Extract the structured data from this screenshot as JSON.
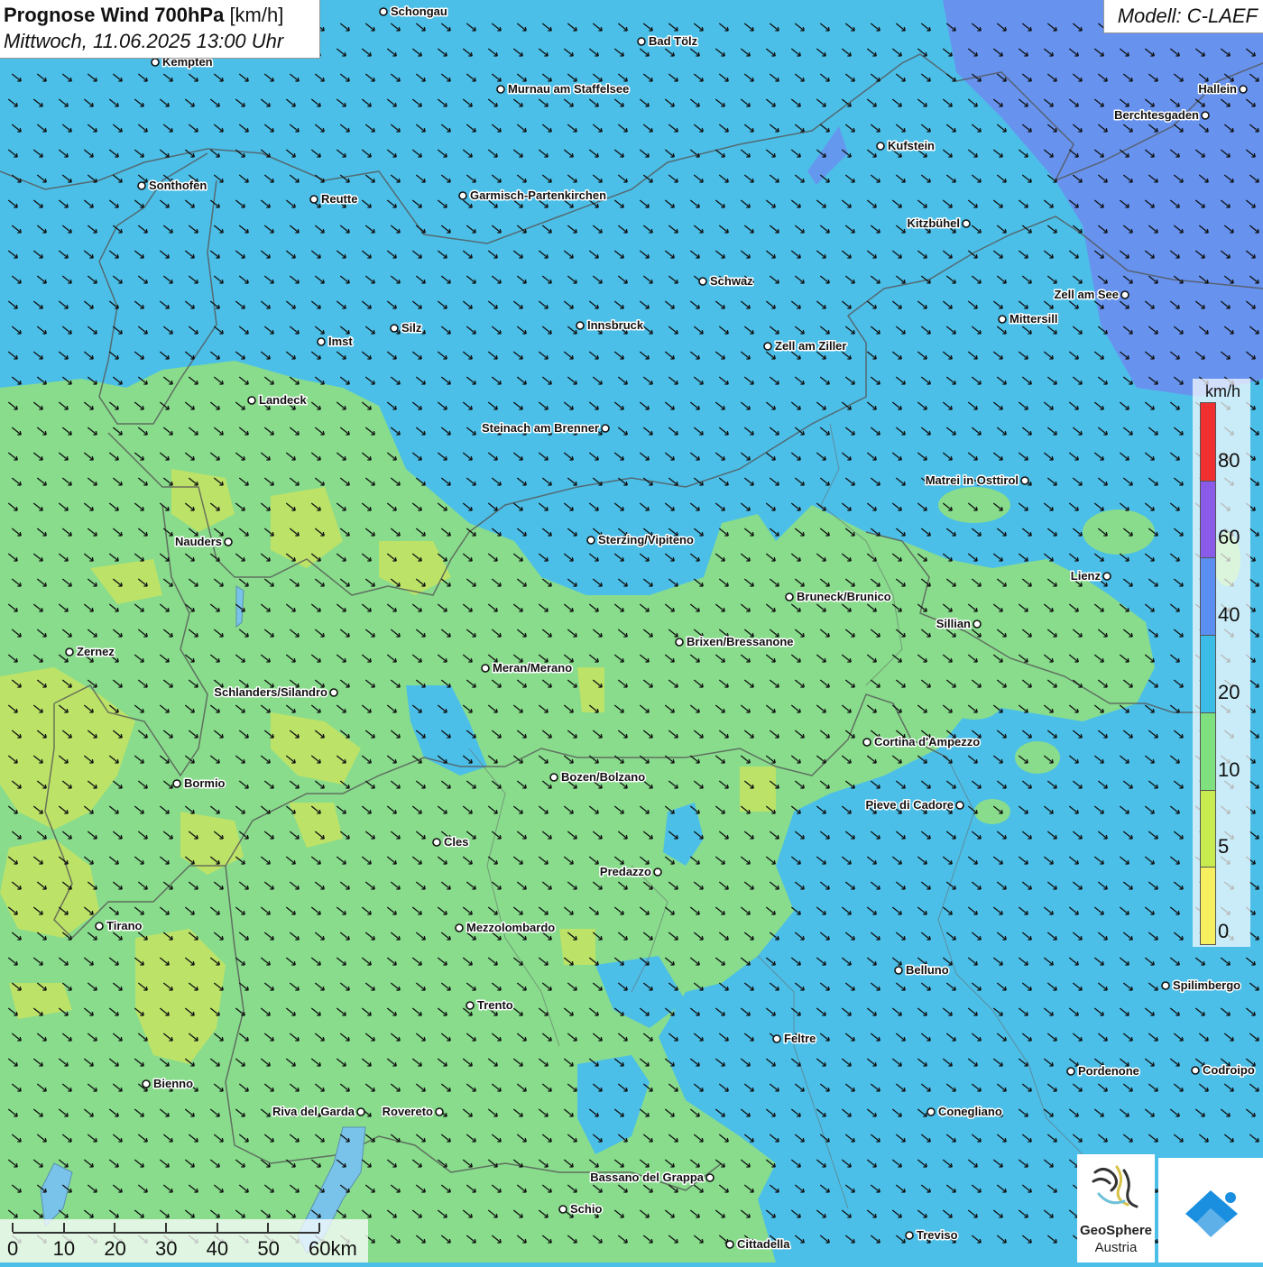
{
  "title": {
    "main": "Prognose Wind 700hPa",
    "unit": "[km/h]",
    "datetime": "Mittwoch, 11.06.2025 13:00 Uhr"
  },
  "model_label": "Modell: C-LAEF",
  "legend": {
    "unit": "km/h",
    "labels": [
      "80",
      "60",
      "40",
      "20",
      "10",
      "5",
      "0"
    ],
    "colors": [
      "#f03030",
      "#8a5ae8",
      "#5a8ef0",
      "#3cbde8",
      "#7ee07e",
      "#c8ec50",
      "#f6f060"
    ]
  },
  "scale_bar": {
    "labels": [
      "0",
      "10",
      "20",
      "30",
      "40",
      "50",
      "60km"
    ]
  },
  "logos": {
    "geosphere_line1": "GeoSphere",
    "geosphere_line2": "Austria"
  },
  "cities": [
    {
      "name": "Schongau"
    },
    {
      "name": "Bad Tölz"
    },
    {
      "name": "Kempten"
    },
    {
      "name": "Murnau am Staffelsee"
    },
    {
      "name": "Hallein"
    },
    {
      "name": "Berchtesgaden"
    },
    {
      "name": "Kufstein"
    },
    {
      "name": "Sonthofen"
    },
    {
      "name": "Reutte"
    },
    {
      "name": "Garmisch-Partenkirchen"
    },
    {
      "name": "Kitzbühel"
    },
    {
      "name": "Schwaz"
    },
    {
      "name": "Zell am See"
    },
    {
      "name": "Mittersill"
    },
    {
      "name": "Innsbruck"
    },
    {
      "name": "Silz"
    },
    {
      "name": "Imst"
    },
    {
      "name": "Zell am Ziller"
    },
    {
      "name": "Landeck"
    },
    {
      "name": "Steinach am Brenner"
    },
    {
      "name": "Matrei in Osttirol"
    },
    {
      "name": "Nauders"
    },
    {
      "name": "Sterzing/Vipiteno"
    },
    {
      "name": "Lienz"
    },
    {
      "name": "Bruneck/Brunico"
    },
    {
      "name": "Sillian"
    },
    {
      "name": "Brixen/Bressanone"
    },
    {
      "name": "Zernez"
    },
    {
      "name": "Meran/Merano"
    },
    {
      "name": "Schlanders/Silandro"
    },
    {
      "name": "Cortina d'Ampezzo"
    },
    {
      "name": "Bozen/Bolzano"
    },
    {
      "name": "Bormio"
    },
    {
      "name": "Pieve di Cadore"
    },
    {
      "name": "Cles"
    },
    {
      "name": "Predazzo"
    },
    {
      "name": "Tirano"
    },
    {
      "name": "Mezzolombardo"
    },
    {
      "name": "Belluno"
    },
    {
      "name": "Spilimbergo"
    },
    {
      "name": "Trento"
    },
    {
      "name": "Feltre"
    },
    {
      "name": "Pordenone"
    },
    {
      "name": "Codroipo"
    },
    {
      "name": "Bienno"
    },
    {
      "name": "Riva del Garda"
    },
    {
      "name": "Rovereto"
    },
    {
      "name": "Conegliano"
    },
    {
      "name": "Bassano del Grappa"
    },
    {
      "name": "Schio"
    },
    {
      "name": "Treviso"
    },
    {
      "name": "Cittadella"
    }
  ]
}
